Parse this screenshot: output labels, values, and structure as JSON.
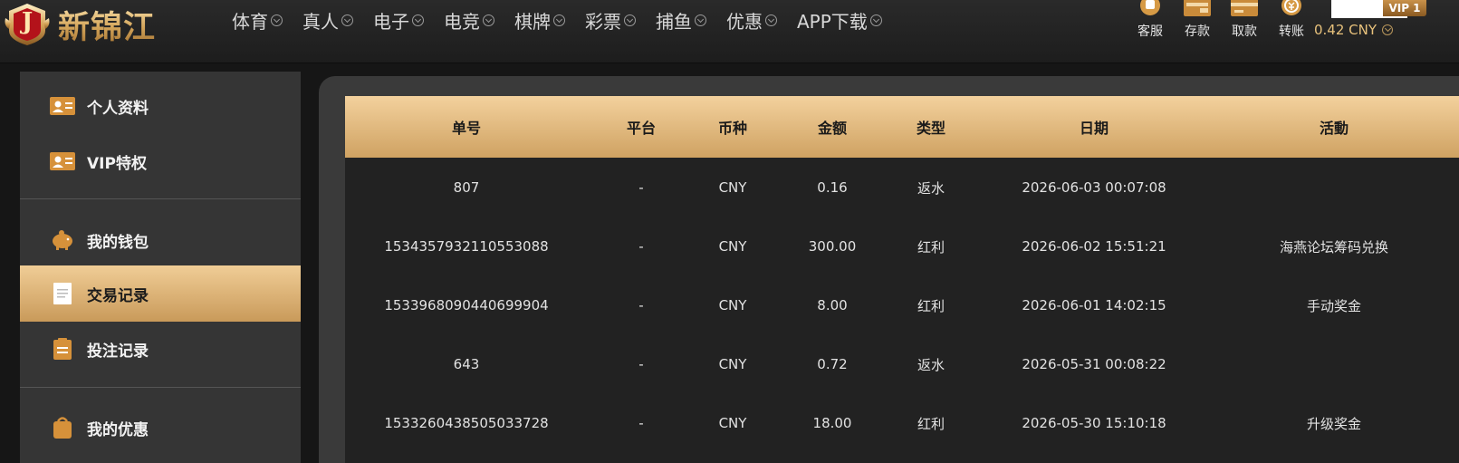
{
  "brand": {
    "name": "新锦江",
    "badge_letter": "J"
  },
  "nav": {
    "items": [
      {
        "label": "体育"
      },
      {
        "label": "真人"
      },
      {
        "label": "电子"
      },
      {
        "label": "电竞"
      },
      {
        "label": "棋牌"
      },
      {
        "label": "彩票"
      },
      {
        "label": "捕鱼"
      },
      {
        "label": "优惠"
      },
      {
        "label": "APP下载"
      }
    ]
  },
  "tools": {
    "service": {
      "label": "客服",
      "icon": "headset-icon"
    },
    "deposit": {
      "label": "存款",
      "icon": "wallet-icon"
    },
    "withdraw": {
      "label": "取款",
      "icon": "card-icon"
    },
    "transfer": {
      "label": "转账",
      "icon": "coin-icon"
    }
  },
  "account": {
    "balance": "0.42 CNY",
    "vip": "VIP 1"
  },
  "sidebar": {
    "items": [
      {
        "label": "个人资料",
        "icon": "id-card-icon"
      },
      {
        "label": "VIP特权",
        "icon": "vip-card-icon"
      },
      {
        "label": "我的钱包",
        "icon": "piggy-bank-icon"
      },
      {
        "label": "交易记录",
        "icon": "document-icon"
      },
      {
        "label": "投注记录",
        "icon": "clipboard-icon"
      },
      {
        "label": "我的优惠",
        "icon": "gift-bag-icon"
      }
    ],
    "active_index": 3
  },
  "table": {
    "columns": [
      "单号",
      "平台",
      "币种",
      "金额",
      "类型",
      "日期",
      "活動"
    ],
    "rows": [
      [
        "807",
        "-",
        "CNY",
        "0.16",
        "返水",
        "2026-06-03 00:07:08",
        ""
      ],
      [
        "1534357932110553088",
        "-",
        "CNY",
        "300.00",
        "红利",
        "2026-06-02 15:51:21",
        "海燕论坛筹码兑换"
      ],
      [
        "1533968090440699904",
        "-",
        "CNY",
        "8.00",
        "红利",
        "2026-06-01 14:02:15",
        "手动奖金"
      ],
      [
        "643",
        "-",
        "CNY",
        "0.72",
        "返水",
        "2026-05-31 00:08:22",
        ""
      ],
      [
        "1533260438505033728",
        "-",
        "CNY",
        "18.00",
        "红利",
        "2026-05-30 15:10:18",
        "升级奖金"
      ]
    ]
  },
  "colors": {
    "accent_gold": "#d4a55a",
    "header_bg": "#222222",
    "table_header": "#e6bd80"
  }
}
